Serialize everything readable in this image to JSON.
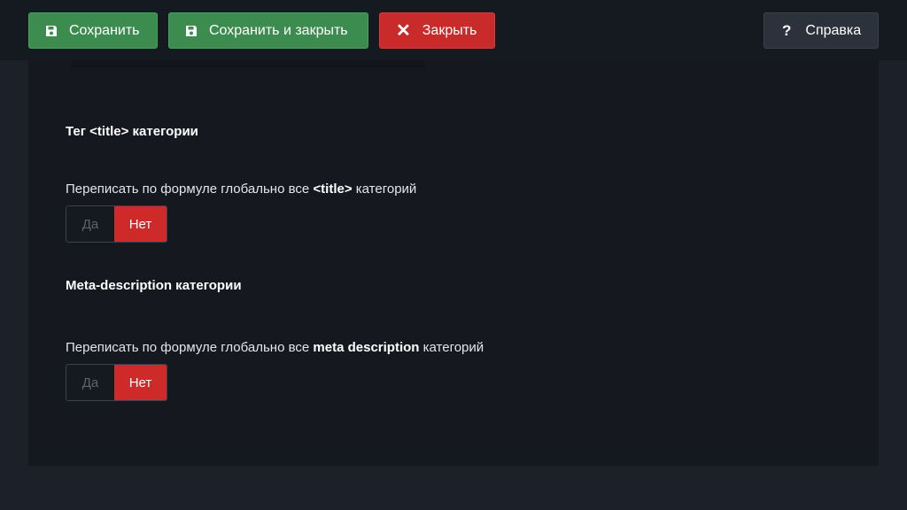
{
  "toolbar": {
    "save_label": "Сохранить",
    "save_close_label": "Сохранить и закрыть",
    "close_label": "Закрыть",
    "help_label": "Справка",
    "help_glyph": "?",
    "close_glyph": "✕"
  },
  "sections": [
    {
      "title": "Тег <title> категории",
      "field": {
        "label_before": "Переписать по формуле глобально все ",
        "label_bold": "<title>",
        "label_after": " категорий",
        "option_yes": "Да",
        "option_no": "Нет",
        "selected": "Нет"
      }
    },
    {
      "title": "Meta-description категории",
      "field": {
        "label_before": "Переписать по формуле глобально все ",
        "label_bold": "meta description",
        "label_after": " категорий",
        "option_yes": "Да",
        "option_no": "Нет",
        "selected": "Нет"
      }
    }
  ],
  "colors": {
    "success": "#3d8c4f",
    "danger": "#c92b2b",
    "neutral": "#2c323b",
    "background": "#1c2028",
    "panel": "#15191f"
  },
  "icons": {
    "save": "floppy-disk-icon",
    "close": "close-icon",
    "help": "question-icon"
  }
}
